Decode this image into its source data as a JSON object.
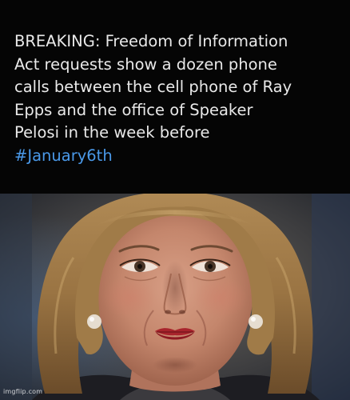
{
  "caption": {
    "lines": [
      "BREAKING: Freedom of Information",
      "Act requests show a dozen phone",
      "calls between the cell phone of Ray",
      "Epps and the office of Speaker",
      "Pelosi in the week before"
    ],
    "hashtag": "#January6th"
  },
  "colors": {
    "background": "#050505",
    "text": "#e9e9e9",
    "hashtag": "#4a99e9"
  },
  "photo": {
    "subject": "close-up portrait photo of a woman with shoulder-length blonde hair and red lipstick"
  },
  "watermark": "imgflip.com"
}
